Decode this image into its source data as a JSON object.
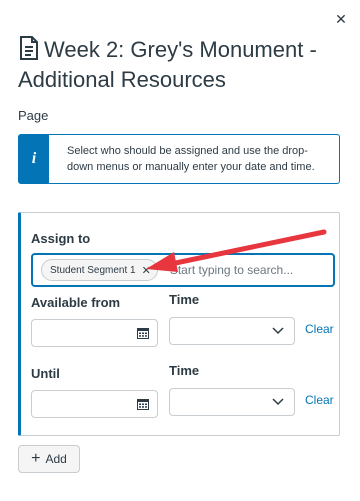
{
  "header": {
    "close_glyph": "✕",
    "title": "Week 2: Grey's Monument - Additional Resources",
    "title_icon": "document-icon"
  },
  "item_type": "Page",
  "info_banner": {
    "icon": "i",
    "text": "Select who should be assigned and use the drop-down menus or manually enter your date and time."
  },
  "assign_card": {
    "assign_to_label": "Assign to",
    "tokens": [
      {
        "label": "Student Segment 1",
        "remove_glyph": "✕"
      }
    ],
    "search_placeholder": "Start typing to search...",
    "available_from_label": "Available from",
    "available_from_value": "",
    "time_label_1": "Time",
    "time_value_1": "",
    "clear_label_1": "Clear",
    "until_label": "Until",
    "until_value": "",
    "time_label_2": "Time",
    "time_value_2": "",
    "clear_label_2": "Clear"
  },
  "add_button": {
    "label": "Add",
    "plus_glyph": "+"
  },
  "colors": {
    "accent": "#0374b5",
    "annotation_arrow": "#e8363f",
    "text": "#2d3b45",
    "border": "#c7cdd1"
  }
}
